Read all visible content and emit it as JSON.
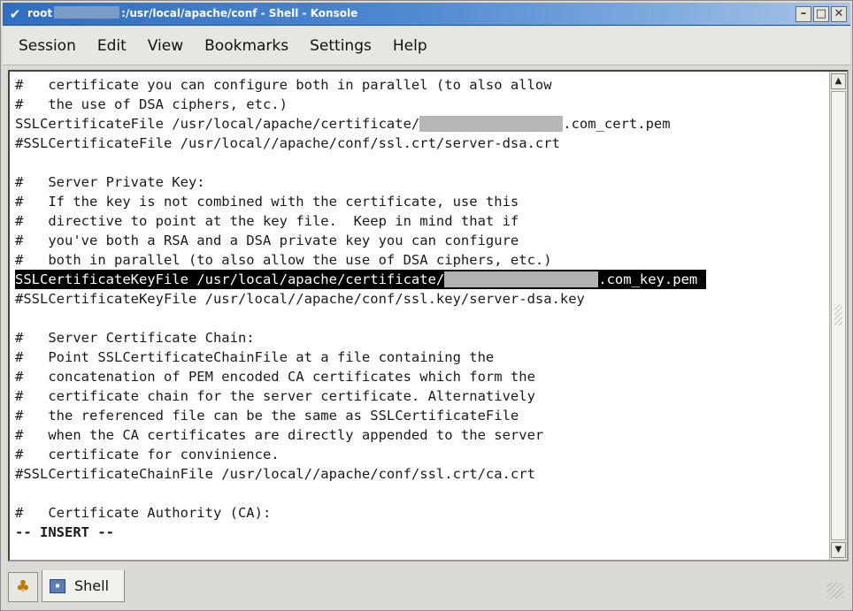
{
  "window": {
    "title_prefix": "root",
    "title_suffix": ":/usr/local/apache/conf - Shell - Konsole",
    "controls": {
      "minimize": "–",
      "maximize": "□",
      "close": "✕"
    }
  },
  "menubar": {
    "items": [
      "Session",
      "Edit",
      "View",
      "Bookmarks",
      "Settings",
      "Help"
    ]
  },
  "terminal": {
    "lines": [
      {
        "text": "#   certificate you can configure both in parallel (to also allow"
      },
      {
        "text": "#   the use of DSA ciphers, etc.)"
      },
      {
        "before": "SSLCertificateFile /usr/local/apache/certificate/",
        "after": ".com_cert.pem"
      },
      {
        "text": "#SSLCertificateFile /usr/local//apache/conf/ssl.crt/server-dsa.crt"
      },
      {
        "text": ""
      },
      {
        "text": "#   Server Private Key:"
      },
      {
        "text": "#   If the key is not combined with the certificate, use this"
      },
      {
        "text": "#   directive to point at the key file.  Keep in mind that if"
      },
      {
        "text": "#   you've both a RSA and a DSA private key you can configure"
      },
      {
        "text": "#   both in parallel (to also allow the use of DSA ciphers, etc.)"
      },
      {
        "before": "SSLCertificateKeyFile /usr/local/apache/certificate/",
        "after": ".com_key.pem "
      },
      {
        "text": "#SSLCertificateKeyFile /usr/local//apache/conf/ssl.key/server-dsa.key"
      },
      {
        "text": ""
      },
      {
        "text": "#   Server Certificate Chain:"
      },
      {
        "text": "#   Point SSLCertificateChainFile at a file containing the"
      },
      {
        "text": "#   concatenation of PEM encoded CA certificates which form the"
      },
      {
        "text": "#   certificate chain for the server certificate. Alternatively"
      },
      {
        "text": "#   the referenced file can be the same as SSLCertificateFile"
      },
      {
        "text": "#   when the CA certificates are directly appended to the server"
      },
      {
        "text": "#   certificate for convinience."
      },
      {
        "text": "#SSLCertificateChainFile /usr/local//apache/conf/ssl.crt/ca.crt"
      },
      {
        "text": ""
      },
      {
        "text": "#   Certificate Authority (CA):"
      },
      {
        "text": "-- INSERT --"
      }
    ],
    "scroll_up": "▲",
    "scroll_down": "▼"
  },
  "tabs": {
    "new_session_icon": "new-session-icon",
    "shell_tab_label": "Shell",
    "shell_tab_icon": "terminal-icon"
  }
}
